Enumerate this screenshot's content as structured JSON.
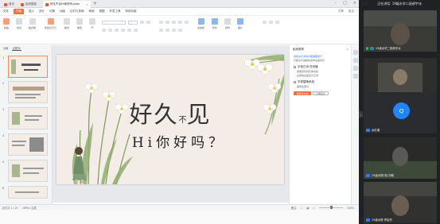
{
  "app": {
    "tabs": [
      {
        "label": "首页"
      },
      {
        "label": "稻壳模板"
      },
      {
        "label": "好久不见Hi你好吗.pptx"
      }
    ],
    "menu": [
      "文件",
      "开始",
      "插入",
      "设计",
      "切换",
      "动画",
      "幻灯片放映",
      "审阅",
      "视图",
      "开发工具",
      "特色功能"
    ],
    "menu_right": [
      "分享",
      "批注"
    ],
    "toolbar": {
      "paste": "粘贴",
      "cut": "剪切",
      "format": "格式刷",
      "new_slide": "新建幻灯片",
      "layout": "版式",
      "reset": "重置",
      "section": "节",
      "textbox": "文本框",
      "shape": "形状",
      "arrange": "排列",
      "picture": "图片"
    },
    "panel_tabs": [
      "大纲",
      "幻灯片"
    ],
    "slide_numbers": [
      "1",
      "2",
      "3",
      "4",
      "5",
      "6"
    ],
    "slide": {
      "title_a": "好久",
      "title_small": "不",
      "title_b": "见",
      "subtitle": "Hi你好吗？"
    },
    "side_pane": {
      "title": "稻壳推荐",
      "line1": "你的演示文稿可能需要用于",
      "line2": "可能演示放映和多种设备同步",
      "opt1": "字体已设 任何输",
      "opt1_sub1": "保留原有的字体风格",
      "opt1_sub2": "在其他设备显示正常",
      "opt2": "字体替换系统",
      "opt2_sub": "兼容性更好",
      "btn_primary": "保存至文档",
      "btn_ghost": "不再显示"
    },
    "status": {
      "slide_pos": "幻灯片 1 / 21",
      "theme": "Office 主题",
      "note": "备注",
      "zoom": "100%"
    }
  },
  "meeting": {
    "title": "正在讲话: 19级水学二班郝宇冰",
    "participants": [
      {
        "name": "19级水学二班郝宇冰",
        "kind": "video",
        "badge": "blue"
      },
      {
        "name": "19级水院 李语涵",
        "kind": "video",
        "badge": "orange"
      },
      {
        "name": "余红缨",
        "kind": "avatar",
        "initial": "Q",
        "badge": "blue"
      },
      {
        "name": "19级水院2班 刘曦",
        "kind": "video",
        "badge": "blue"
      },
      {
        "name": "19级水院 李怡然",
        "kind": "video",
        "badge": "blue"
      }
    ]
  },
  "colors": {
    "accent": "#f2542d",
    "slide_bg": "#f4ece6",
    "meeting_bg": "#202124",
    "avatar_blue": "#1f86ff",
    "mic_green": "#1fbf6a"
  }
}
